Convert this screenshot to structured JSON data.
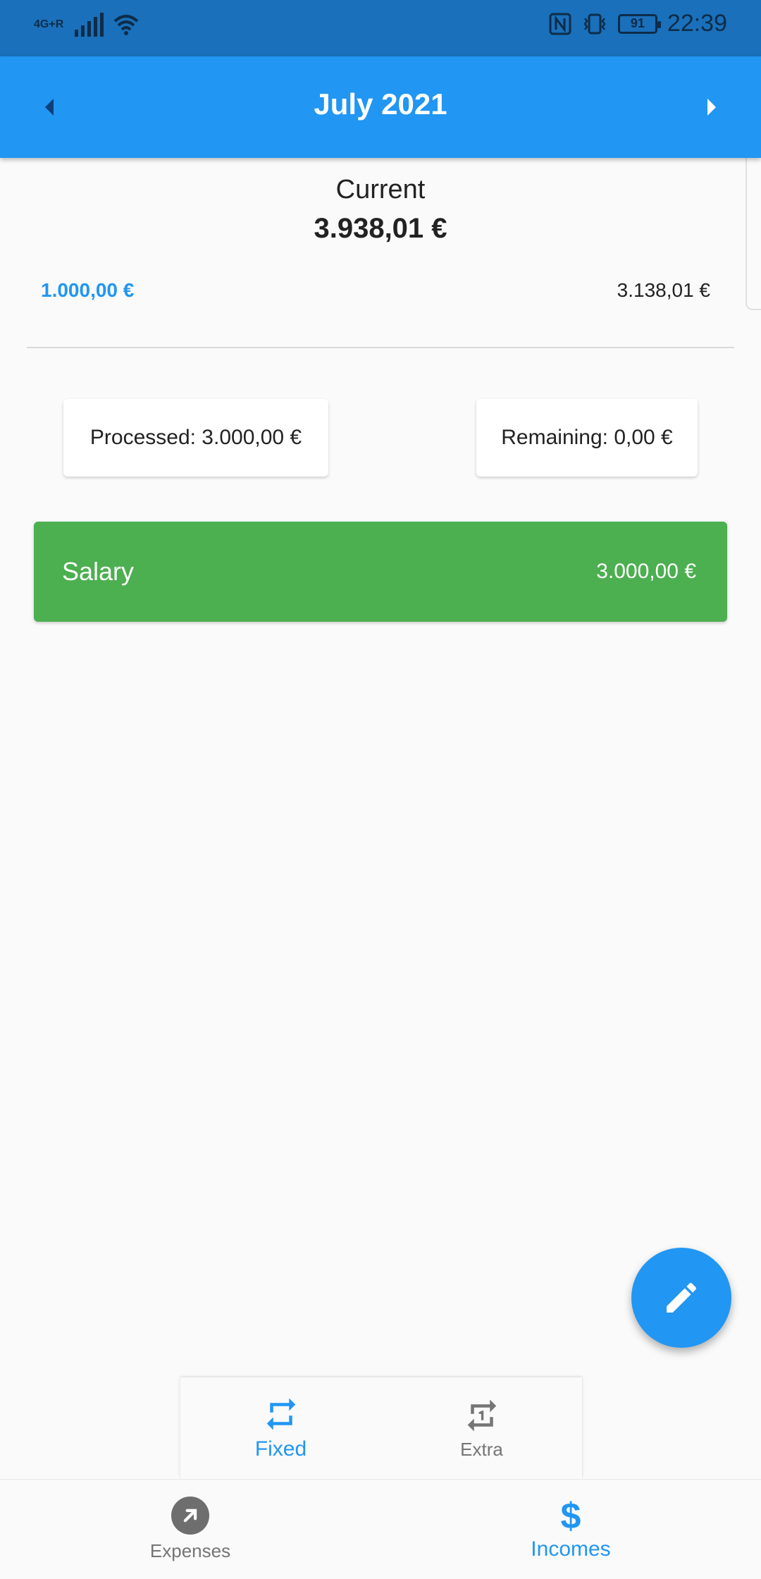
{
  "status_bar": {
    "network": "4G+R",
    "time": "22:39",
    "battery": "91"
  },
  "header": {
    "title": "July 2021"
  },
  "summary": {
    "current_label": "Current",
    "current_amount": "3.938,01 €",
    "left_amount": "1.000,00 €",
    "right_amount": "3.138,01 €"
  },
  "cards": {
    "processed": "Processed: 3.000,00 €",
    "remaining": "Remaining: 0,00 €"
  },
  "entries": [
    {
      "name": "Salary",
      "amount": "3.000,00 €",
      "color": "#4caf50"
    }
  ],
  "sub_tabs": [
    {
      "label": "Fixed",
      "icon": "repeat-icon",
      "active": true
    },
    {
      "label": "Extra",
      "icon": "repeat-one-icon",
      "active": false
    }
  ],
  "bottom_nav": [
    {
      "label": "Expenses",
      "icon": "arrow-up-right-icon",
      "active": false
    },
    {
      "label": "Incomes",
      "icon": "dollar-icon",
      "active": true
    }
  ],
  "colors": {
    "primary": "#2196f3",
    "status_bar": "#1a70ba",
    "income": "#4caf50",
    "inactive": "#757575"
  }
}
